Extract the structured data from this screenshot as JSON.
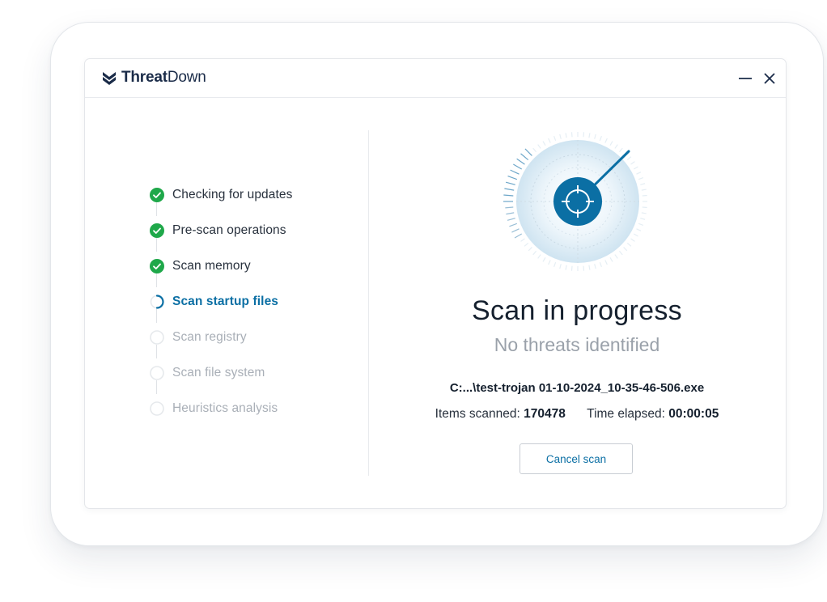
{
  "app": {
    "logo_bold": "Threat",
    "logo_regular": "Down"
  },
  "window_controls": {
    "minimize_icon": "minus-icon",
    "close_icon": "close-icon"
  },
  "steps": [
    {
      "label": "Checking for updates",
      "state": "done"
    },
    {
      "label": "Pre-scan operations",
      "state": "done"
    },
    {
      "label": "Scan memory",
      "state": "done"
    },
    {
      "label": "Scan startup files",
      "state": "active"
    },
    {
      "label": "Scan registry",
      "state": "pending"
    },
    {
      "label": "Scan file system",
      "state": "pending"
    },
    {
      "label": "Heuristics analysis",
      "state": "pending"
    }
  ],
  "scan": {
    "title": "Scan in progress",
    "subtitle": "No threats identified",
    "current_file": "C:...\\test-trojan 01-10-2024_10-35-46-506.exe",
    "items_label": "Items scanned:",
    "items_value": "170478",
    "time_label": "Time elapsed:",
    "time_value": "00:00:05",
    "cancel_label": "Cancel scan"
  },
  "colors": {
    "brand_navy": "#1a2b48",
    "accent_blue": "#0b6fa4",
    "success_green": "#1fa84a",
    "pending_gray": "#a9afb7"
  }
}
